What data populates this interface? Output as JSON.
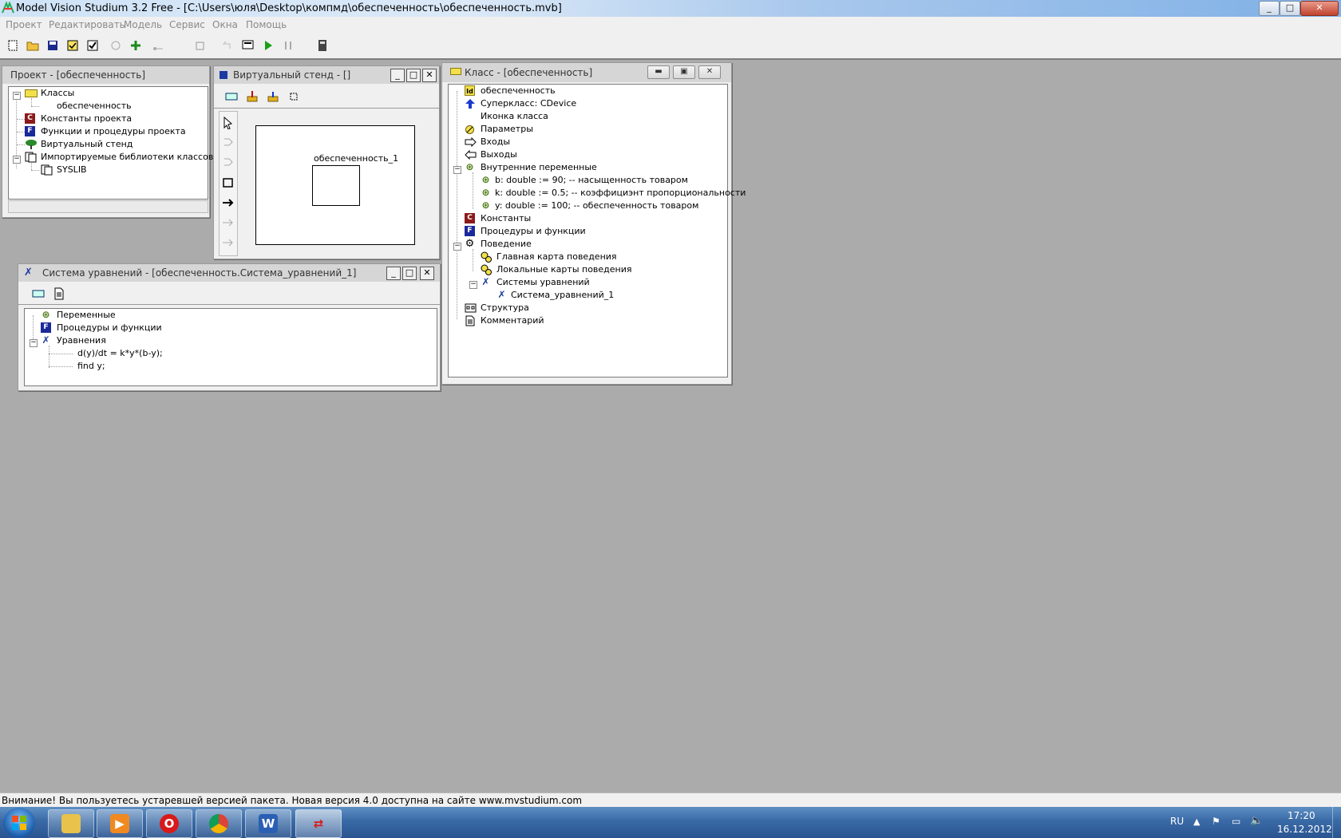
{
  "app": {
    "title": "Model Vision Studium 3.2 Free - [C:\\Users\\юля\\Desktop\\компмд\\обеспеченность\\обеспеченность.mvb]",
    "window_buttons": [
      "_",
      "□",
      "✕"
    ]
  },
  "menu": [
    "Проект",
    "Редактировать",
    "Модель",
    "Сервис",
    "Окна",
    "Помощь"
  ],
  "project_window": {
    "title": "Проект - [обеспеченность]",
    "tree": [
      {
        "label": "Классы",
        "icon": "classes-icon"
      },
      {
        "label": "обеспеченность",
        "icon": ""
      },
      {
        "label": "Константы проекта",
        "icon": "constants-icon"
      },
      {
        "label": "Функции и процедуры проекта",
        "icon": "functions-icon"
      },
      {
        "label": "Виртуальный стенд",
        "icon": "stand-icon"
      },
      {
        "label": "Импортируемые библиотеки классов",
        "icon": "libraries-icon"
      },
      {
        "label": "SYSLIB",
        "icon": "library-icon"
      }
    ]
  },
  "stand_window": {
    "title": "Виртуальный стенд - []",
    "block_label": "обеспеченность_1"
  },
  "equations_window": {
    "title": "Система уравнений - [обеспеченность.Система_уравнений_1]",
    "tree": [
      {
        "label": "Переменные"
      },
      {
        "label": "Процедуры и функции"
      },
      {
        "label": "Уравнения"
      },
      {
        "label": "d(y)/dt = k*y*(b-y);"
      },
      {
        "label": "find y;"
      }
    ]
  },
  "class_window": {
    "title": "Класс - [обеспеченность]",
    "tree": [
      {
        "label": "обеспеченность"
      },
      {
        "label": "Суперкласс: CDevice"
      },
      {
        "label": "Иконка класса"
      },
      {
        "label": "Параметры"
      },
      {
        "label": "Входы"
      },
      {
        "label": "Выходы"
      },
      {
        "label": "Внутренние переменные"
      },
      {
        "label": "b: double := 90; -- насыщенность товаром"
      },
      {
        "label": "k: double := 0.5; -- коэффициэнт пропорциональности"
      },
      {
        "label": "y: double := 100; -- обеспеченность товаром"
      },
      {
        "label": "Константы"
      },
      {
        "label": "Процедуры и функции"
      },
      {
        "label": "Поведение"
      },
      {
        "label": "Главная карта поведения"
      },
      {
        "label": "Локальные карты поведения"
      },
      {
        "label": "Системы уравнений"
      },
      {
        "label": "Система_уравнений_1"
      },
      {
        "label": "Структура"
      },
      {
        "label": "Комментарий"
      }
    ]
  },
  "status": "Внимание! Вы пользуетесь устаревшей версией пакета. Новая версия 4.0 доступна на сайте www.mvstudium.com",
  "taskbar": {
    "lang": "RU",
    "time": "17:20",
    "date": "16.12.2012"
  }
}
